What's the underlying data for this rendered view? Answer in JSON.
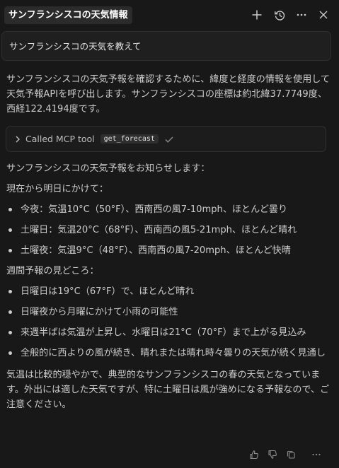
{
  "header": {
    "title": "サンフランシスコの天気情報"
  },
  "prompt": {
    "text": "サンフランシスコの天気を教えて"
  },
  "response": {
    "intro": "サンフランシスコの天気予報を確認するために、緯度と経度の情報を使用して天気予報APIを呼び出します。サンフランシスコの座標は約北緯37.7749度、西経122.4194度です。",
    "tool_call": {
      "label": "Called MCP tool",
      "tool_name": "get_forecast"
    },
    "forecast_intro": "サンフランシスコの天気予報をお知らせします：",
    "section1_heading": "現在から明日にかけて：",
    "section1_items": [
      "今夜：気温10°C（50°F）、西南西の風7-10mph、ほとんど曇り",
      "土曜日：気温20°C（68°F）、西南西の風5-21mph、ほとんど晴れ",
      "土曜夜：気温9°C（48°F）、西南西の風7-20mph、ほとんど快晴"
    ],
    "section2_heading": "週間予報の見どころ：",
    "section2_items": [
      "日曜日は19°C（67°F）で、ほとんど晴れ",
      "日曜夜から月曜にかけて小雨の可能性",
      "来週半ばは気温が上昇し、水曜日は21°C（70°F）まで上がる見込み",
      "全般的に西よりの風が続き、晴れまたは晴れ時々曇りの天気が続く見通し"
    ],
    "closing": "気温は比較的穏やかで、典型的なサンフランシスコの春の天気となっています。外出には適した天気ですが、特に土曜日は風が強めになる予報なので、ご注意ください。"
  },
  "icons": {
    "header": [
      "plus-icon",
      "history-icon",
      "more-icon",
      "close-icon"
    ],
    "footer": [
      "thumbs-up-icon",
      "thumbs-down-icon",
      "copy-icon",
      "more-icon"
    ]
  }
}
